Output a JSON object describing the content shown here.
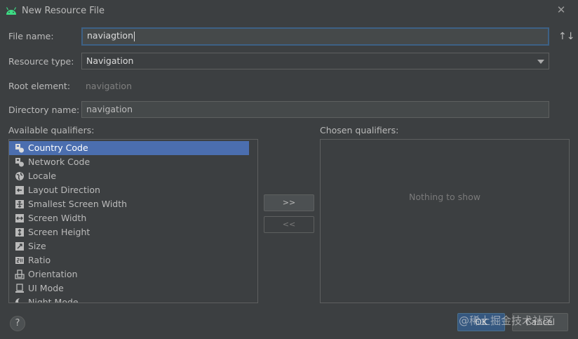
{
  "window": {
    "title": "New Resource File",
    "close_glyph": "✕"
  },
  "form": {
    "file_name_label": "File name:",
    "file_name_value": "naviagtion",
    "sort_glyph": "↑↓",
    "resource_type_label": "Resource type:",
    "resource_type_value": "Navigation",
    "root_element_label": "Root element:",
    "root_element_value": "navigation",
    "directory_name_label": "Directory name:",
    "directory_name_value": "navigation"
  },
  "qualifiers": {
    "available_label": "Available qualifiers:",
    "chosen_label": "Chosen qualifiers:",
    "chosen_empty_text": "Nothing to show",
    "items": [
      {
        "label": "Country Code",
        "icon": "country-code-icon",
        "selected": true
      },
      {
        "label": "Network Code",
        "icon": "network-code-icon"
      },
      {
        "label": "Locale",
        "icon": "globe-icon"
      },
      {
        "label": "Layout Direction",
        "icon": "layout-direction-icon"
      },
      {
        "label": "Smallest Screen Width",
        "icon": "smallest-width-icon"
      },
      {
        "label": "Screen Width",
        "icon": "screen-width-icon"
      },
      {
        "label": "Screen Height",
        "icon": "screen-height-icon"
      },
      {
        "label": "Size",
        "icon": "size-icon"
      },
      {
        "label": "Ratio",
        "icon": "ratio-icon"
      },
      {
        "label": "Orientation",
        "icon": "orientation-icon"
      },
      {
        "label": "UI Mode",
        "icon": "ui-mode-icon"
      },
      {
        "label": "Night Mode",
        "icon": "night-mode-icon"
      }
    ],
    "add_button": ">>",
    "remove_button": "<<"
  },
  "footer": {
    "help_glyph": "?",
    "ok_label": "OK",
    "cancel_label": "Cancel",
    "watermark": "@稀土掘金技术社区"
  },
  "colors": {
    "background": "#3c3f41",
    "selection": "#4b6eaf",
    "focus_border": "#3d6185",
    "primary_button": "#365880",
    "android_green": "#3ddc84"
  }
}
